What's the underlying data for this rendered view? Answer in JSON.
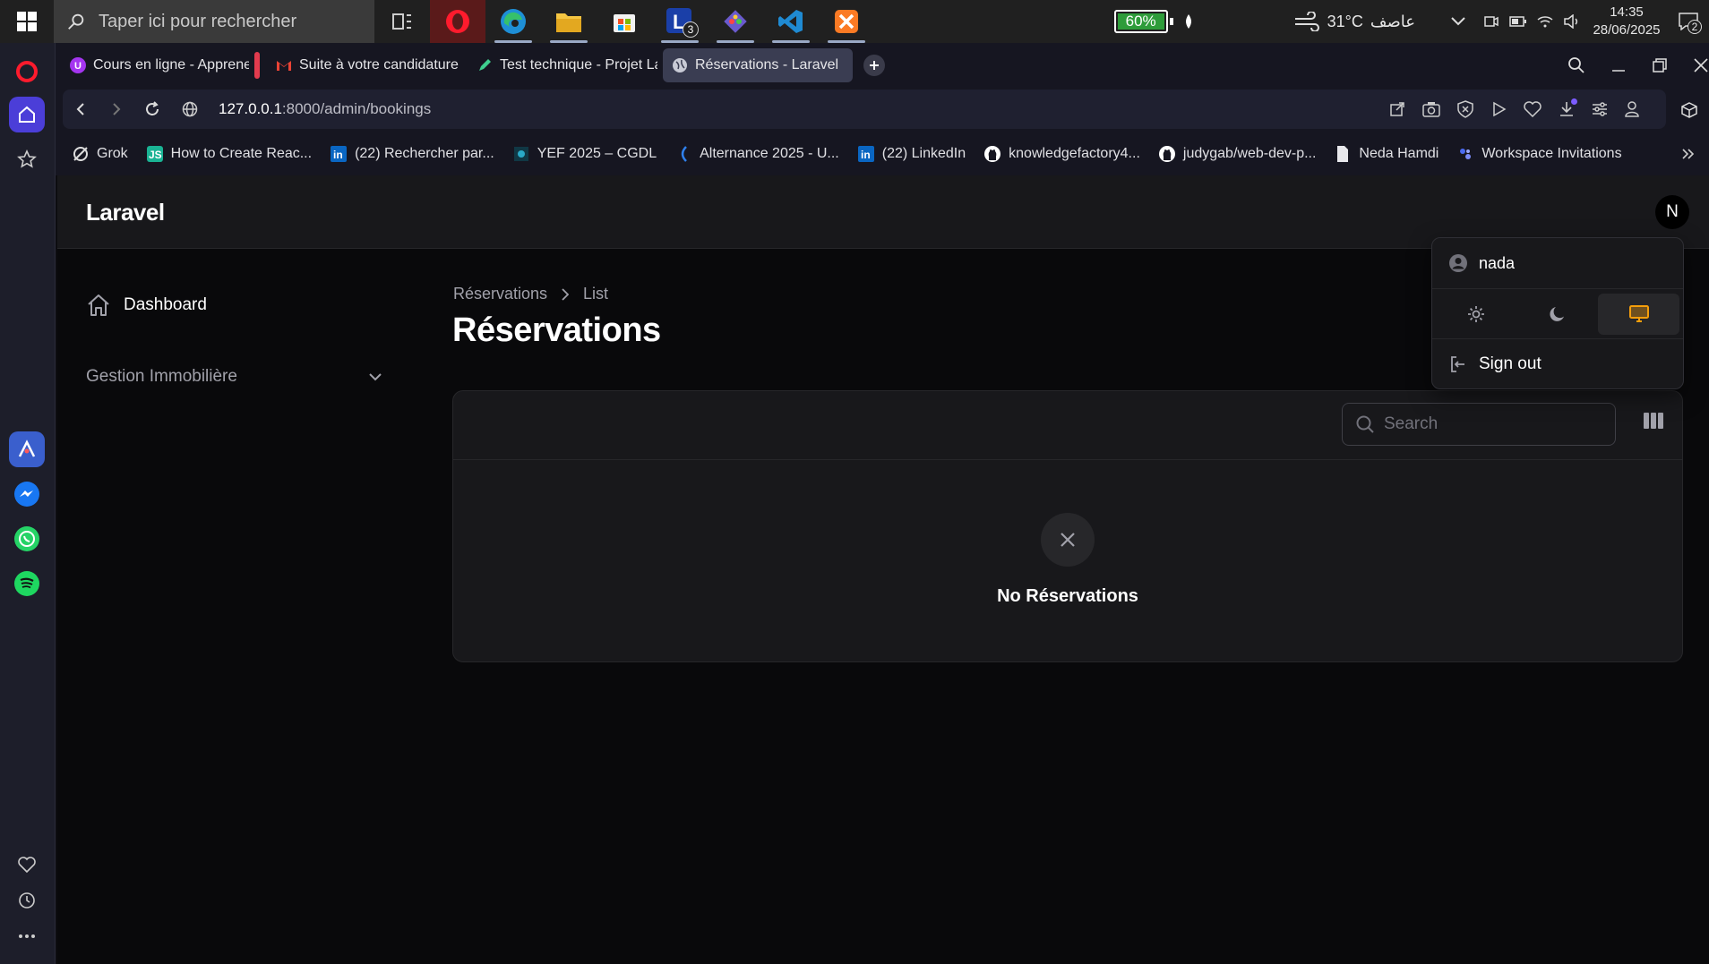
{
  "taskbar": {
    "search_placeholder": "Taper ici pour rechercher",
    "battery": "60%",
    "temperature": "31°C",
    "weather_text": "عاصف",
    "time": "14:35",
    "date": "28/06/2025",
    "notification_count": "2",
    "launcher_badge": "3"
  },
  "tabs": [
    {
      "label": "Cours en ligne - Apprenez"
    },
    {
      "label": "Suite à votre candidature -"
    },
    {
      "label": "Test technique - Projet Lar"
    },
    {
      "label": "Réservations - Laravel"
    }
  ],
  "address": {
    "host": "127.0.0.1",
    "path": ":8000/admin/bookings"
  },
  "bookmarks": [
    {
      "label": "Grok"
    },
    {
      "label": "How to Create Reac..."
    },
    {
      "label": "(22) Rechercher par..."
    },
    {
      "label": "YEF 2025 – CGDL"
    },
    {
      "label": "Alternance 2025 - U..."
    },
    {
      "label": "(22) LinkedIn"
    },
    {
      "label": "knowledgefactory4..."
    },
    {
      "label": "judygab/web-dev-p..."
    },
    {
      "label": "Neda Hamdi"
    },
    {
      "label": "Workspace Invitations"
    }
  ],
  "app": {
    "brand": "Laravel",
    "avatar_initial": "N",
    "nav": {
      "dashboard": "Dashboard",
      "group": "Gestion Immobilière"
    },
    "breadcrumb": {
      "root": "Réservations",
      "current": "List"
    },
    "title": "Réservations",
    "search_placeholder": "Search",
    "empty_message": "No Réservations"
  },
  "user_menu": {
    "username": "nada",
    "sign_out": "Sign out",
    "theme_selected": "system"
  },
  "colors": {
    "accent": "#f59e0b",
    "opera_red": "#ff1b2d",
    "battery_green": "#2e9c3a"
  }
}
